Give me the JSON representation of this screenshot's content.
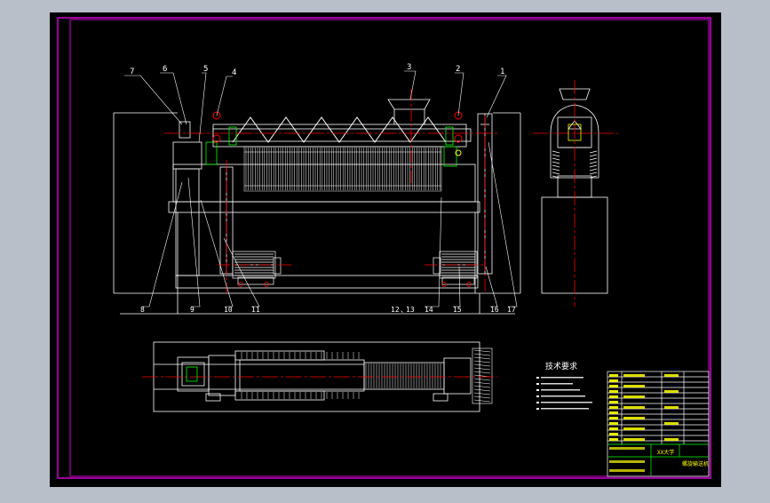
{
  "colors": {
    "viewport_bg": "#b8bfc9",
    "paper": "#000000",
    "frame": "#ff00ff",
    "outline": "#ffffff",
    "centerline": "#ff0000",
    "accent": "#00ff00",
    "tag": "#ffff00",
    "part": "#00ffff"
  },
  "callouts_top": [
    "7",
    "6",
    "5",
    "4",
    "3",
    "2",
    "1"
  ],
  "callouts_bottom": [
    "8",
    "9",
    "10",
    "11",
    "12",
    "13",
    "14",
    "15",
    "16",
    "17"
  ],
  "notes_title": "技术要求",
  "title_block": {
    "drawing_title": "螺旋输送机",
    "school": "XX大学"
  }
}
